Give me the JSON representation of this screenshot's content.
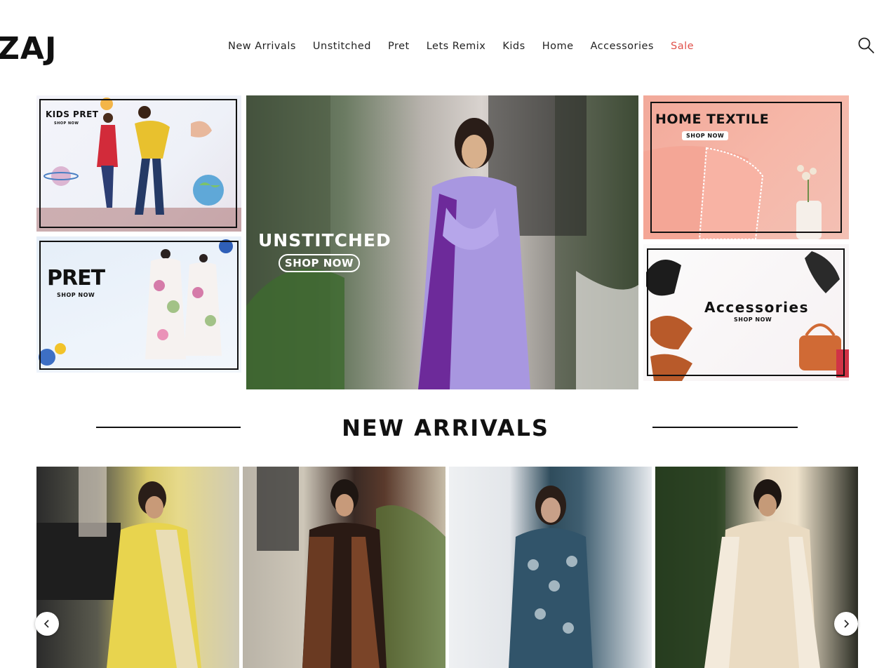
{
  "header": {
    "logo": "ZAJ",
    "nav": [
      {
        "label": "New Arrivals"
      },
      {
        "label": "Unstitched"
      },
      {
        "label": "Pret"
      },
      {
        "label": "Lets Remix"
      },
      {
        "label": "Kids"
      },
      {
        "label": "Home"
      },
      {
        "label": "Accessories"
      },
      {
        "label": "Sale"
      }
    ],
    "search_icon": "search-icon"
  },
  "banners": {
    "kids": {
      "title": "KIDS PRET",
      "cta": "SHOP NOW"
    },
    "pret": {
      "title": "PRET",
      "cta": "SHOP NOW"
    },
    "hero": {
      "title": "UNSTITCHED",
      "cta": "SHOP NOW"
    },
    "home": {
      "title": "HOME TEXTILE",
      "cta": "SHOP NOW"
    },
    "accessories": {
      "title": "Accessories",
      "cta": "SHOP NOW"
    }
  },
  "new_arrivals": {
    "title": "NEW ARRIVALS",
    "prev_icon": "chevron-left-icon",
    "next_icon": "chevron-right-icon"
  },
  "colors": {
    "sale": "#e0504a",
    "text": "#111111"
  }
}
